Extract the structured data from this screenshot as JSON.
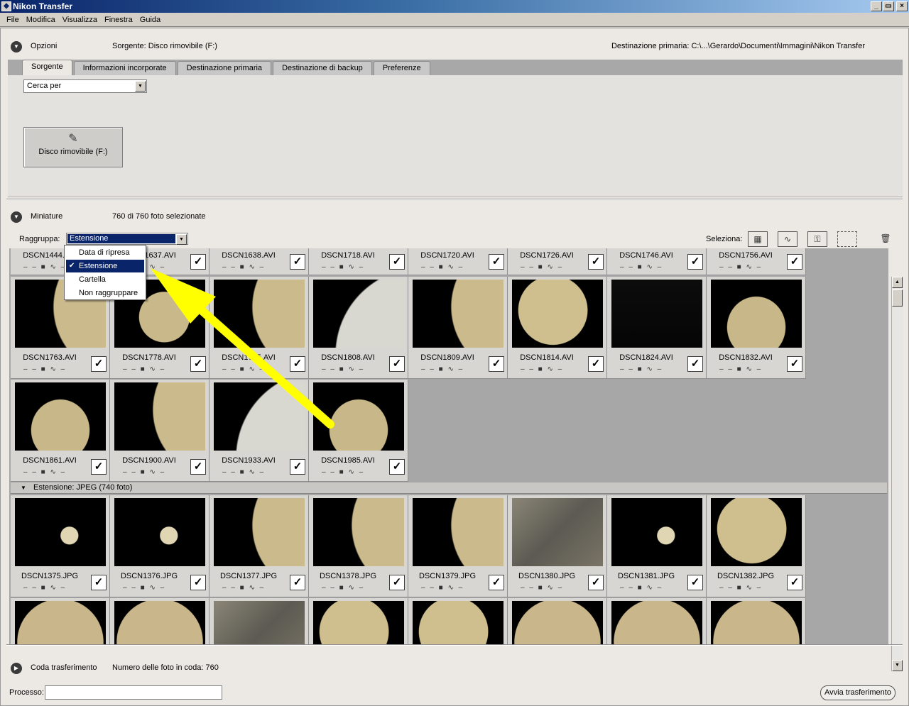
{
  "window": {
    "title": "Nikon Transfer"
  },
  "menu": [
    "File",
    "Modifica",
    "Visualizza",
    "Finestra",
    "Guida"
  ],
  "options": {
    "label": "Opzioni",
    "source": "Sorgente: Disco rimovibile (F:)",
    "destination": "Destinazione primaria:  C:\\...\\Gerardo\\Documenti\\Immagini\\Nikon Transfer",
    "tabs": [
      "Sorgente",
      "Informazioni incorporate",
      "Destinazione primaria",
      "Destinazione di backup",
      "Preferenze"
    ],
    "search_select": "Cerca per",
    "disk_button": "Disco rimovibile (F:)"
  },
  "thumbnails": {
    "label": "Miniature",
    "selected_info": "760 di 760 foto selezionate",
    "group_label": "Raggruppa:",
    "group_value": "Estensione",
    "select_label": "Seleziona:",
    "group_menu": [
      "Data di ripresa",
      "Estensione",
      "Cartella",
      "Non raggruppare"
    ],
    "row0": [
      "DSCN1444.AVI",
      "DSCN1637.AVI",
      "DSCN1638.AVI",
      "DSCN1718.AVI",
      "DSCN1720.AVI",
      "DSCN1726.AVI",
      "DSCN1746.AVI",
      "DSCN1756.AVI"
    ],
    "row1": [
      "DSCN1763.AVI",
      "DSCN1778.AVI",
      "DSCN1795.AVI",
      "DSCN1808.AVI",
      "DSCN1809.AVI",
      "DSCN1814.AVI",
      "DSCN1824.AVI",
      "DSCN1832.AVI"
    ],
    "row2": [
      "DSCN1861.AVI",
      "DSCN1900.AVI",
      "DSCN1933.AVI",
      "DSCN1985.AVI"
    ],
    "jpeg_group": "Estensione: JPEG (740 foto)",
    "row3": [
      "DSCN1375.JPG",
      "DSCN1376.JPG",
      "DSCN1377.JPG",
      "DSCN1378.JPG",
      "DSCN1379.JPG",
      "DSCN1380.JPG",
      "DSCN1381.JPG",
      "DSCN1382.JPG"
    ]
  },
  "queue": {
    "label": "Coda trasferimento",
    "info": "Numero delle foto in coda: 760"
  },
  "footer": {
    "process_label": "Processo:",
    "start_button": "Avvia trasferimento"
  }
}
